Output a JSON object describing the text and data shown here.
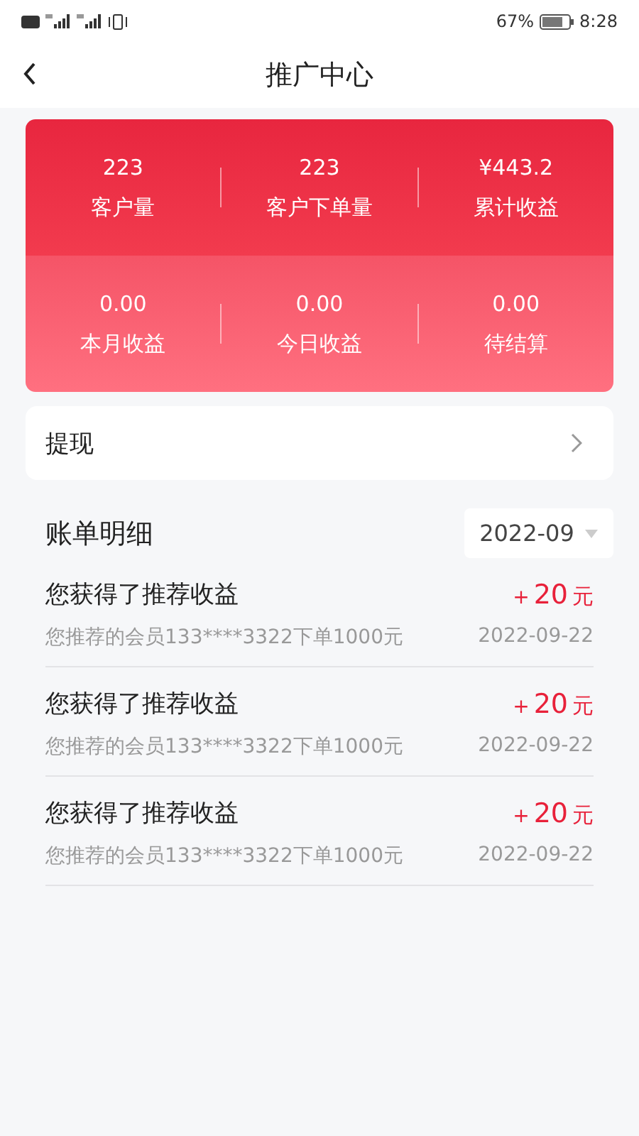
{
  "status_bar": {
    "battery_text": "67%",
    "time": "8:28"
  },
  "header": {
    "title": "推广中心"
  },
  "stats": [
    [
      {
        "value": "223",
        "label": "客户量"
      },
      {
        "value": "223",
        "label": "客户下单量"
      },
      {
        "value": "¥443.2",
        "label": "累计收益"
      }
    ],
    [
      {
        "value": "0.00",
        "label": "本月收益"
      },
      {
        "value": "0.00",
        "label": "今日收益"
      },
      {
        "value": "0.00",
        "label": "待结算"
      }
    ]
  ],
  "withdraw": {
    "label": "提现"
  },
  "bills": {
    "title": "账单明细",
    "month": "2022-09",
    "items": [
      {
        "title": "您获得了推荐收益",
        "sign": "+",
        "amount": "20",
        "unit": "元",
        "detail": "您推荐的会员133****3322下单1000元",
        "date": "2022-09-22"
      },
      {
        "title": "您获得了推荐收益",
        "sign": "+",
        "amount": "20",
        "unit": "元",
        "detail": "您推荐的会员133****3322下单1000元",
        "date": "2022-09-22"
      },
      {
        "title": "您获得了推荐收益",
        "sign": "+",
        "amount": "20",
        "unit": "元",
        "detail": "您推荐的会员133****3322下单1000元",
        "date": "2022-09-22"
      }
    ]
  }
}
